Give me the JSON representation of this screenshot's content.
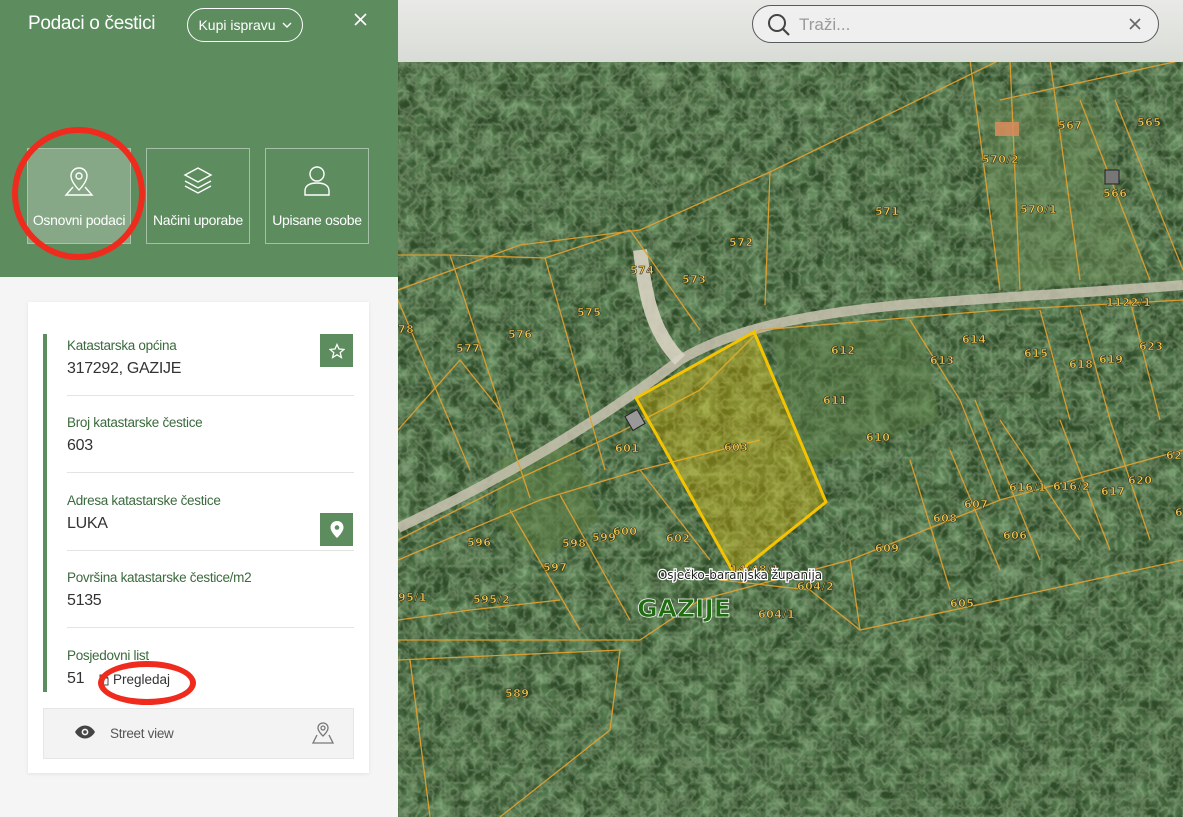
{
  "panel": {
    "title": "Podaci o čestici",
    "buy_button": "Kupi ispravu",
    "tabs": [
      {
        "label": "Osnovni podaci",
        "icon": "map-pin-icon",
        "active": true
      },
      {
        "label": "Načini uporabe",
        "icon": "layers-icon",
        "active": false
      },
      {
        "label": "Upisane osobe",
        "icon": "user-icon",
        "active": false
      }
    ],
    "fields": [
      {
        "key": "Katastarska općina",
        "value": "317292, GAZIJE"
      },
      {
        "key": "Broj katastarske čestice",
        "value": "603"
      },
      {
        "key": "Adresa katastarske čestice",
        "value": "LUKA"
      },
      {
        "key": "Površina katastarske čestice/m2",
        "value": "5135"
      },
      {
        "key": "Posjedovni list",
        "value": "51"
      }
    ],
    "view_link": "Pregledaj",
    "street_view": "Street view",
    "accent_color": "#5d8c5f",
    "annotation_color": "#ef2b1e"
  },
  "search": {
    "placeholder": "Traži..."
  },
  "map": {
    "place_label": "GAZIJE",
    "county_label": "Osječko-baranjska županija",
    "selected_parcel": "603",
    "highlight_color": "#f5c400",
    "parcel_labels": [
      "567",
      "565",
      "570/2",
      "566",
      "570/1",
      "571",
      "572",
      "574",
      "573",
      "575",
      "576",
      "577",
      "78",
      "1122/1",
      "612",
      "614",
      "615",
      "618",
      "619",
      "623",
      "613",
      "611",
      "610",
      "601",
      "603",
      "602",
      "600",
      "599",
      "598",
      "596",
      "597",
      "595/2",
      "95/1",
      "609",
      "608",
      "607",
      "606",
      "616/1",
      "616/2",
      "617",
      "620",
      "62",
      "6",
      "604/2",
      "604/1",
      "605",
      "14/48/1",
      "589"
    ]
  }
}
